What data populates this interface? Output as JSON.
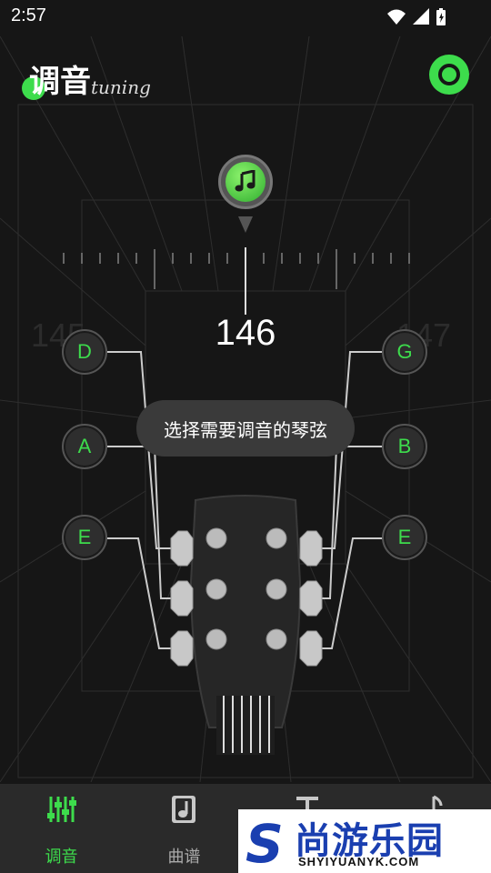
{
  "status": {
    "time": "2:57"
  },
  "header": {
    "title": "调音",
    "subtitle": "tuning"
  },
  "tuner": {
    "frequency": "146",
    "frequency_prev": "145",
    "frequency_next": "147",
    "hint": "选择需要调音的琴弦"
  },
  "strings": {
    "left": [
      "D",
      "A",
      "E"
    ],
    "right": [
      "G",
      "B",
      "E"
    ]
  },
  "nav": {
    "items": [
      {
        "label": "调音",
        "active": true
      },
      {
        "label": "曲谱",
        "active": false
      },
      {
        "label": "",
        "active": false
      },
      {
        "label": "",
        "active": false
      }
    ]
  },
  "watermark": {
    "brand": "尚游乐园",
    "url": "SHYIYUANYK.COM"
  },
  "colors": {
    "accent": "#3ddc4c",
    "background": "#161616",
    "nav_bg": "#2a2a2a"
  }
}
